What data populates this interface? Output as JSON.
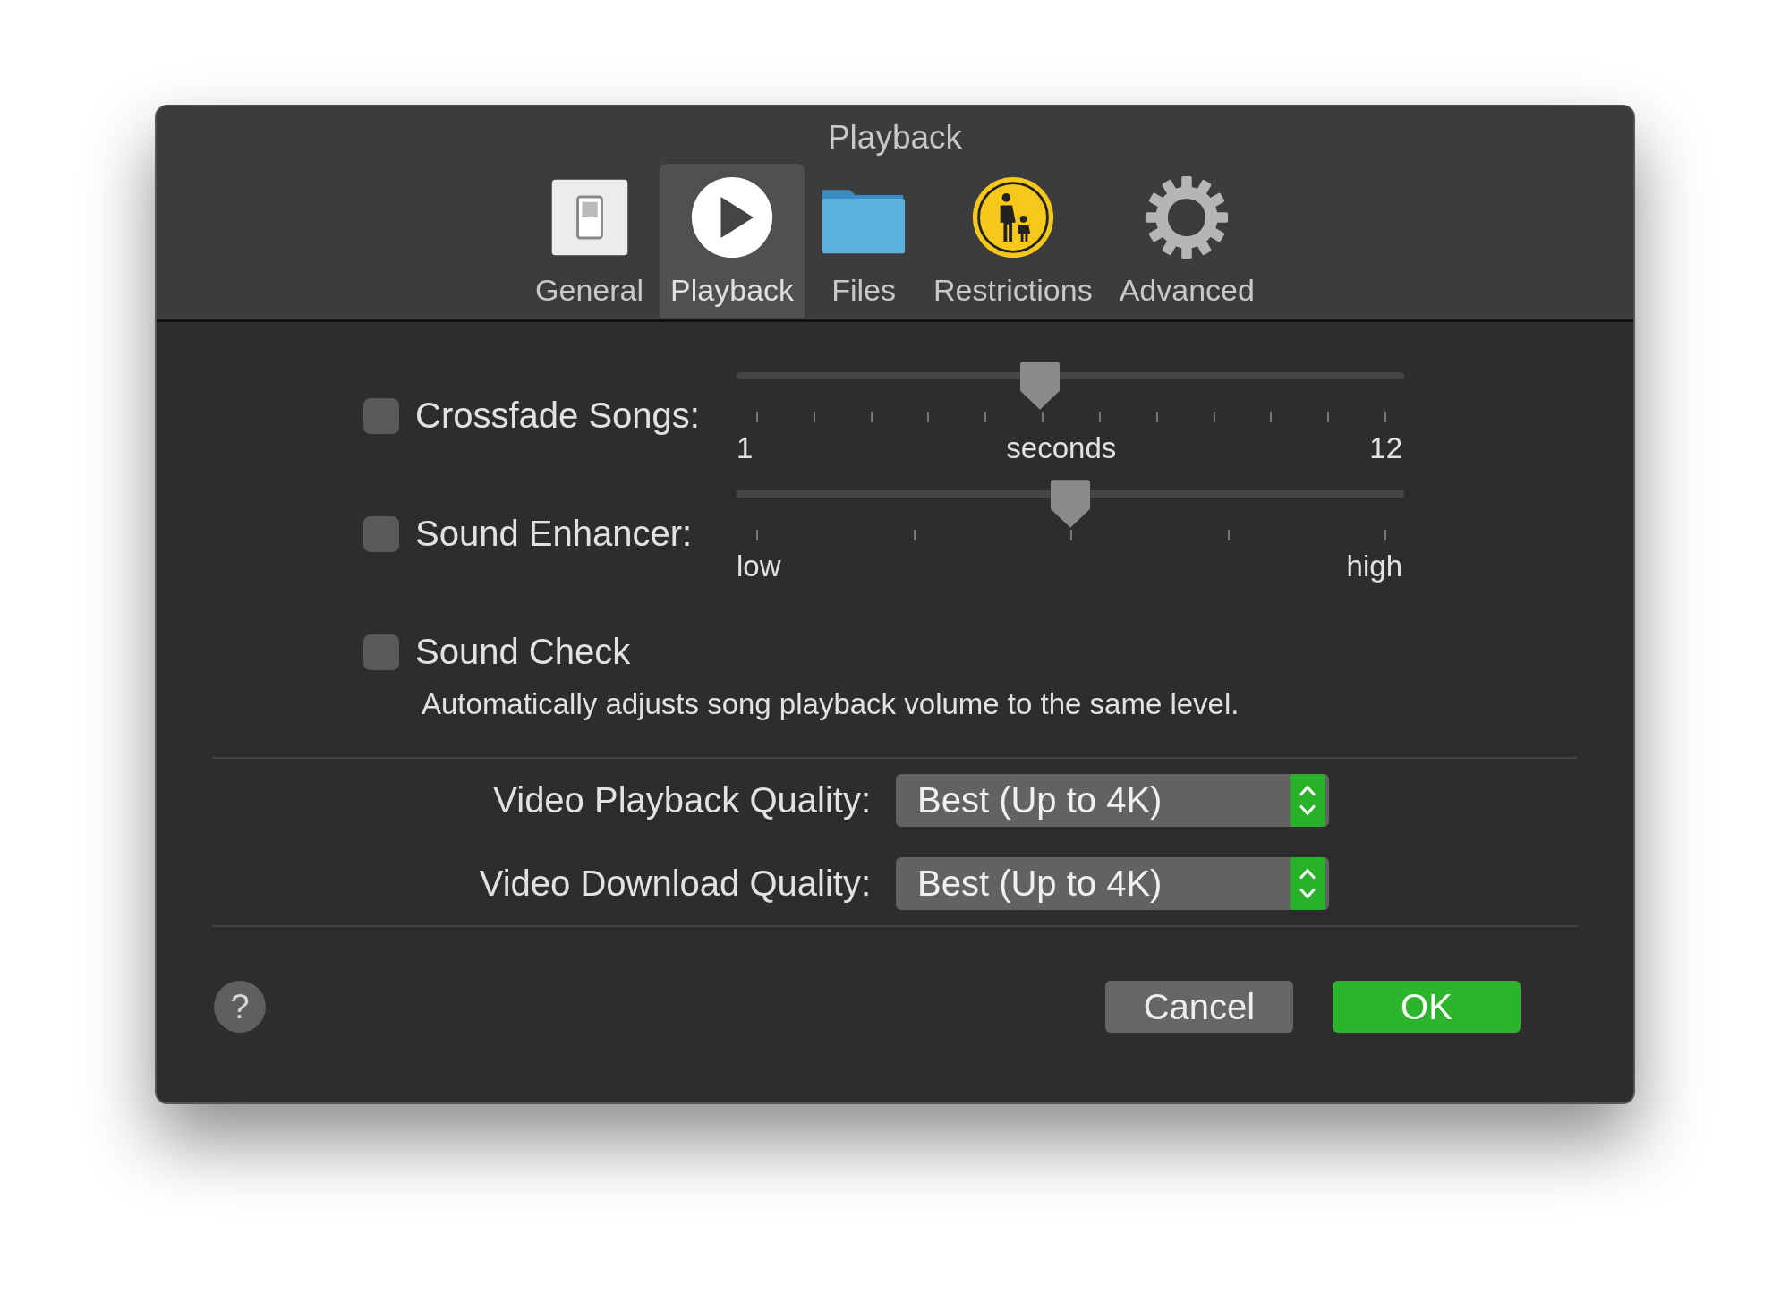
{
  "window": {
    "title": "Playback"
  },
  "toolbar": [
    {
      "label": "General",
      "kind": "switch",
      "selected": false
    },
    {
      "label": "Playback",
      "kind": "play",
      "selected": true
    },
    {
      "label": "Files",
      "kind": "folder",
      "selected": false
    },
    {
      "label": "Restrictions",
      "kind": "parental",
      "selected": false
    },
    {
      "label": "Advanced",
      "kind": "gear",
      "selected": false
    }
  ],
  "options": [
    {
      "label": "Crossfade Songs:",
      "checked": false,
      "slider": {
        "level": 0.4545,
        "kind": "fine",
        "min_label": "1",
        "mid_label": "seconds",
        "max_label": "12"
      }
    },
    {
      "label": "Sound Enhancer:",
      "checked": false,
      "slider": {
        "level": 0.5,
        "kind": "coarse",
        "min_label": "low",
        "max_label": "high"
      }
    },
    {
      "label": "Sound Check",
      "checked": false,
      "description": "Automatically adjusts song playback volume to the same level."
    }
  ],
  "quality": [
    {
      "label": "Video Playback Quality:",
      "value": "Best (Up to 4K)"
    },
    {
      "label": "Video Download Quality:",
      "value": "Best (Up to 4K)"
    }
  ],
  "buttons": [
    {
      "label": "Cancel",
      "kind": "secondary"
    },
    {
      "label": "OK",
      "kind": "primary"
    }
  ],
  "help": {
    "label": "?"
  }
}
